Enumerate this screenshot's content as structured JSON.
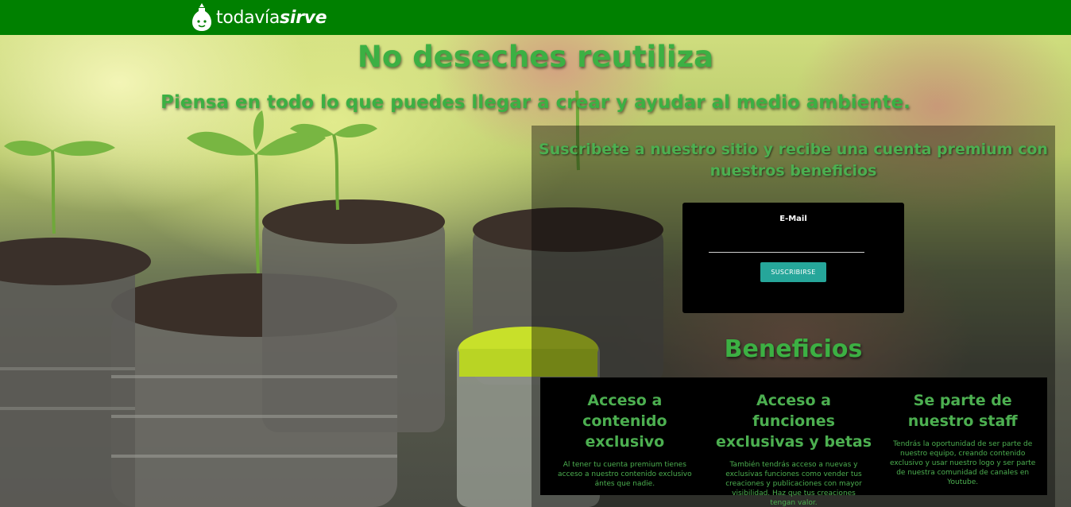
{
  "brand": {
    "logo_light": "todavía",
    "logo_bold": "sirve"
  },
  "hero": {
    "title": "No deseches reutiliza",
    "subtitle": "Piensa en todo lo que puedes llegar a crear y ayudar al medio ambiente."
  },
  "subscribe": {
    "title": "Suscribete a nuestro sitio y recibe una cuenta premium con nuestros beneficios",
    "email_label": "E-Mail",
    "email_value": "",
    "button_label": "SUSCRIBIRSE"
  },
  "benefits": {
    "title": "Beneficios",
    "items": [
      {
        "title": "Acceso a contenido exclusivo",
        "text": "Al tener tu cuenta premium tienes acceso a nuestro contenido exclusivo ántes que nadie."
      },
      {
        "title": "Acceso a funciones exclusivas y betas",
        "text": "También tendrás acceso a nuevas y exclusivas funciones como vender tus creaciones y publicaciones con mayor visibilidad. Haz que tus creaciones tengan valor."
      },
      {
        "title": "Se parte de nuestro staff",
        "text": "Tendrás la oportunidad de ser parte de nuestro equipo, creando contenido exclusivo y usar nuestro logo y ser parte de nuestra comunidad de canales en Youtube."
      }
    ]
  },
  "colors": {
    "topbar": "#008000",
    "accent_green": "#3cb043",
    "button": "#26a69a"
  }
}
